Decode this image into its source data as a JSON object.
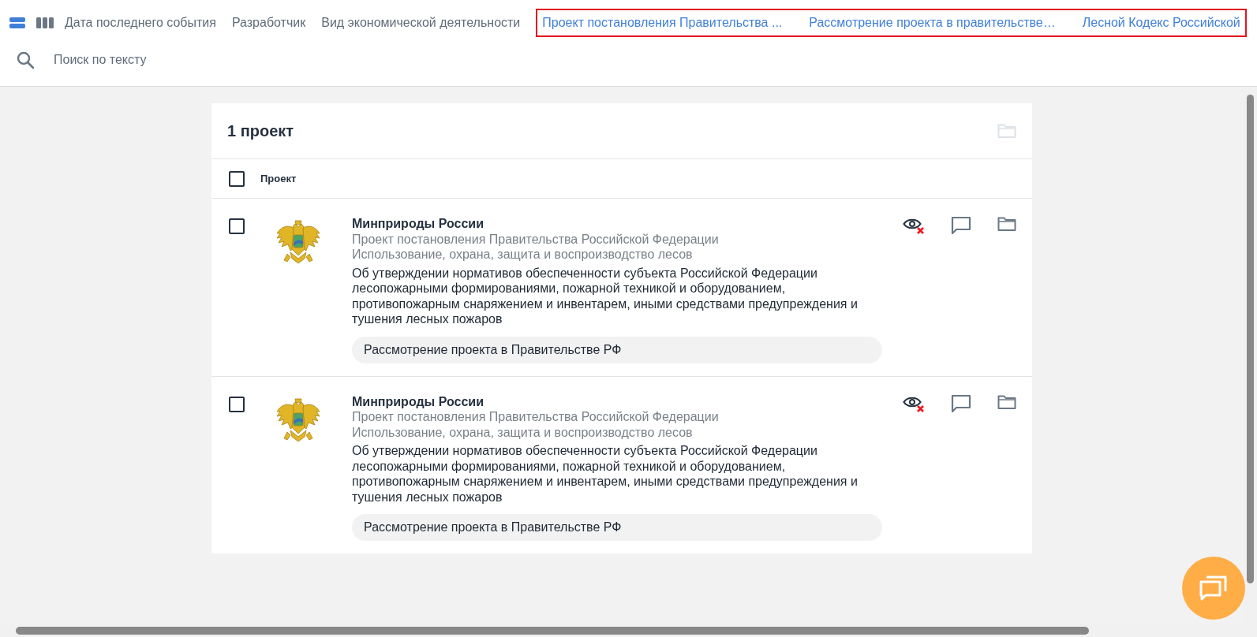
{
  "toolbar": {
    "views": [
      {
        "kind": "rows",
        "selected": true
      },
      {
        "kind": "columns",
        "selected": false
      }
    ],
    "columns": [
      {
        "label": "Дата последнего события",
        "highlighted": false
      },
      {
        "label": "Разработчик",
        "highlighted": false
      },
      {
        "label": "Вид экономической деятельности",
        "highlighted": false
      },
      {
        "label": "Проект постановления Правительства ...",
        "highlighted": true
      },
      {
        "label": "Рассмотрение проекта в правительстве…",
        "highlighted": true
      },
      {
        "label": "Лесной Кодекс Российской",
        "highlighted": true
      }
    ],
    "search": {
      "placeholder": "Поиск по тексту"
    }
  },
  "results": {
    "title": "1 проект",
    "header": {
      "checked": false,
      "label": "Проект"
    },
    "rows": [
      {
        "checked": false,
        "organization": "Минприроды России",
        "document_type": "Проект постановления Правительства Российской Федерации",
        "category": "Использование, охрана, защита и воспроизводство лесов",
        "title": "Об утверждении нормативов обеспеченности субъекта Российской Федерации лесопожарными формированиями, пожарной техникой и оборудованием, противопожарным снаряжением и инвентарем, иными средствами предупреждения и тушения лесных пожаров",
        "stage": "Рассмотрение проекта в Правительстве РФ"
      },
      {
        "checked": false,
        "organization": "Минприроды России",
        "document_type": "Проект постановления Правительства Российской Федерации",
        "category": "Использование, охрана, защита и воспроизводство лесов",
        "title": "Об утверждении нормативов обеспеченности субъекта Российской Федерации лесопожарными формированиями, пожарной техникой и оборудованием, противопожарным снаряжением и инвентарем, иными средствами предупреждения и тушения лесных пожаров",
        "stage": "Рассмотрение проекта в Правительстве РФ"
      }
    ]
  }
}
